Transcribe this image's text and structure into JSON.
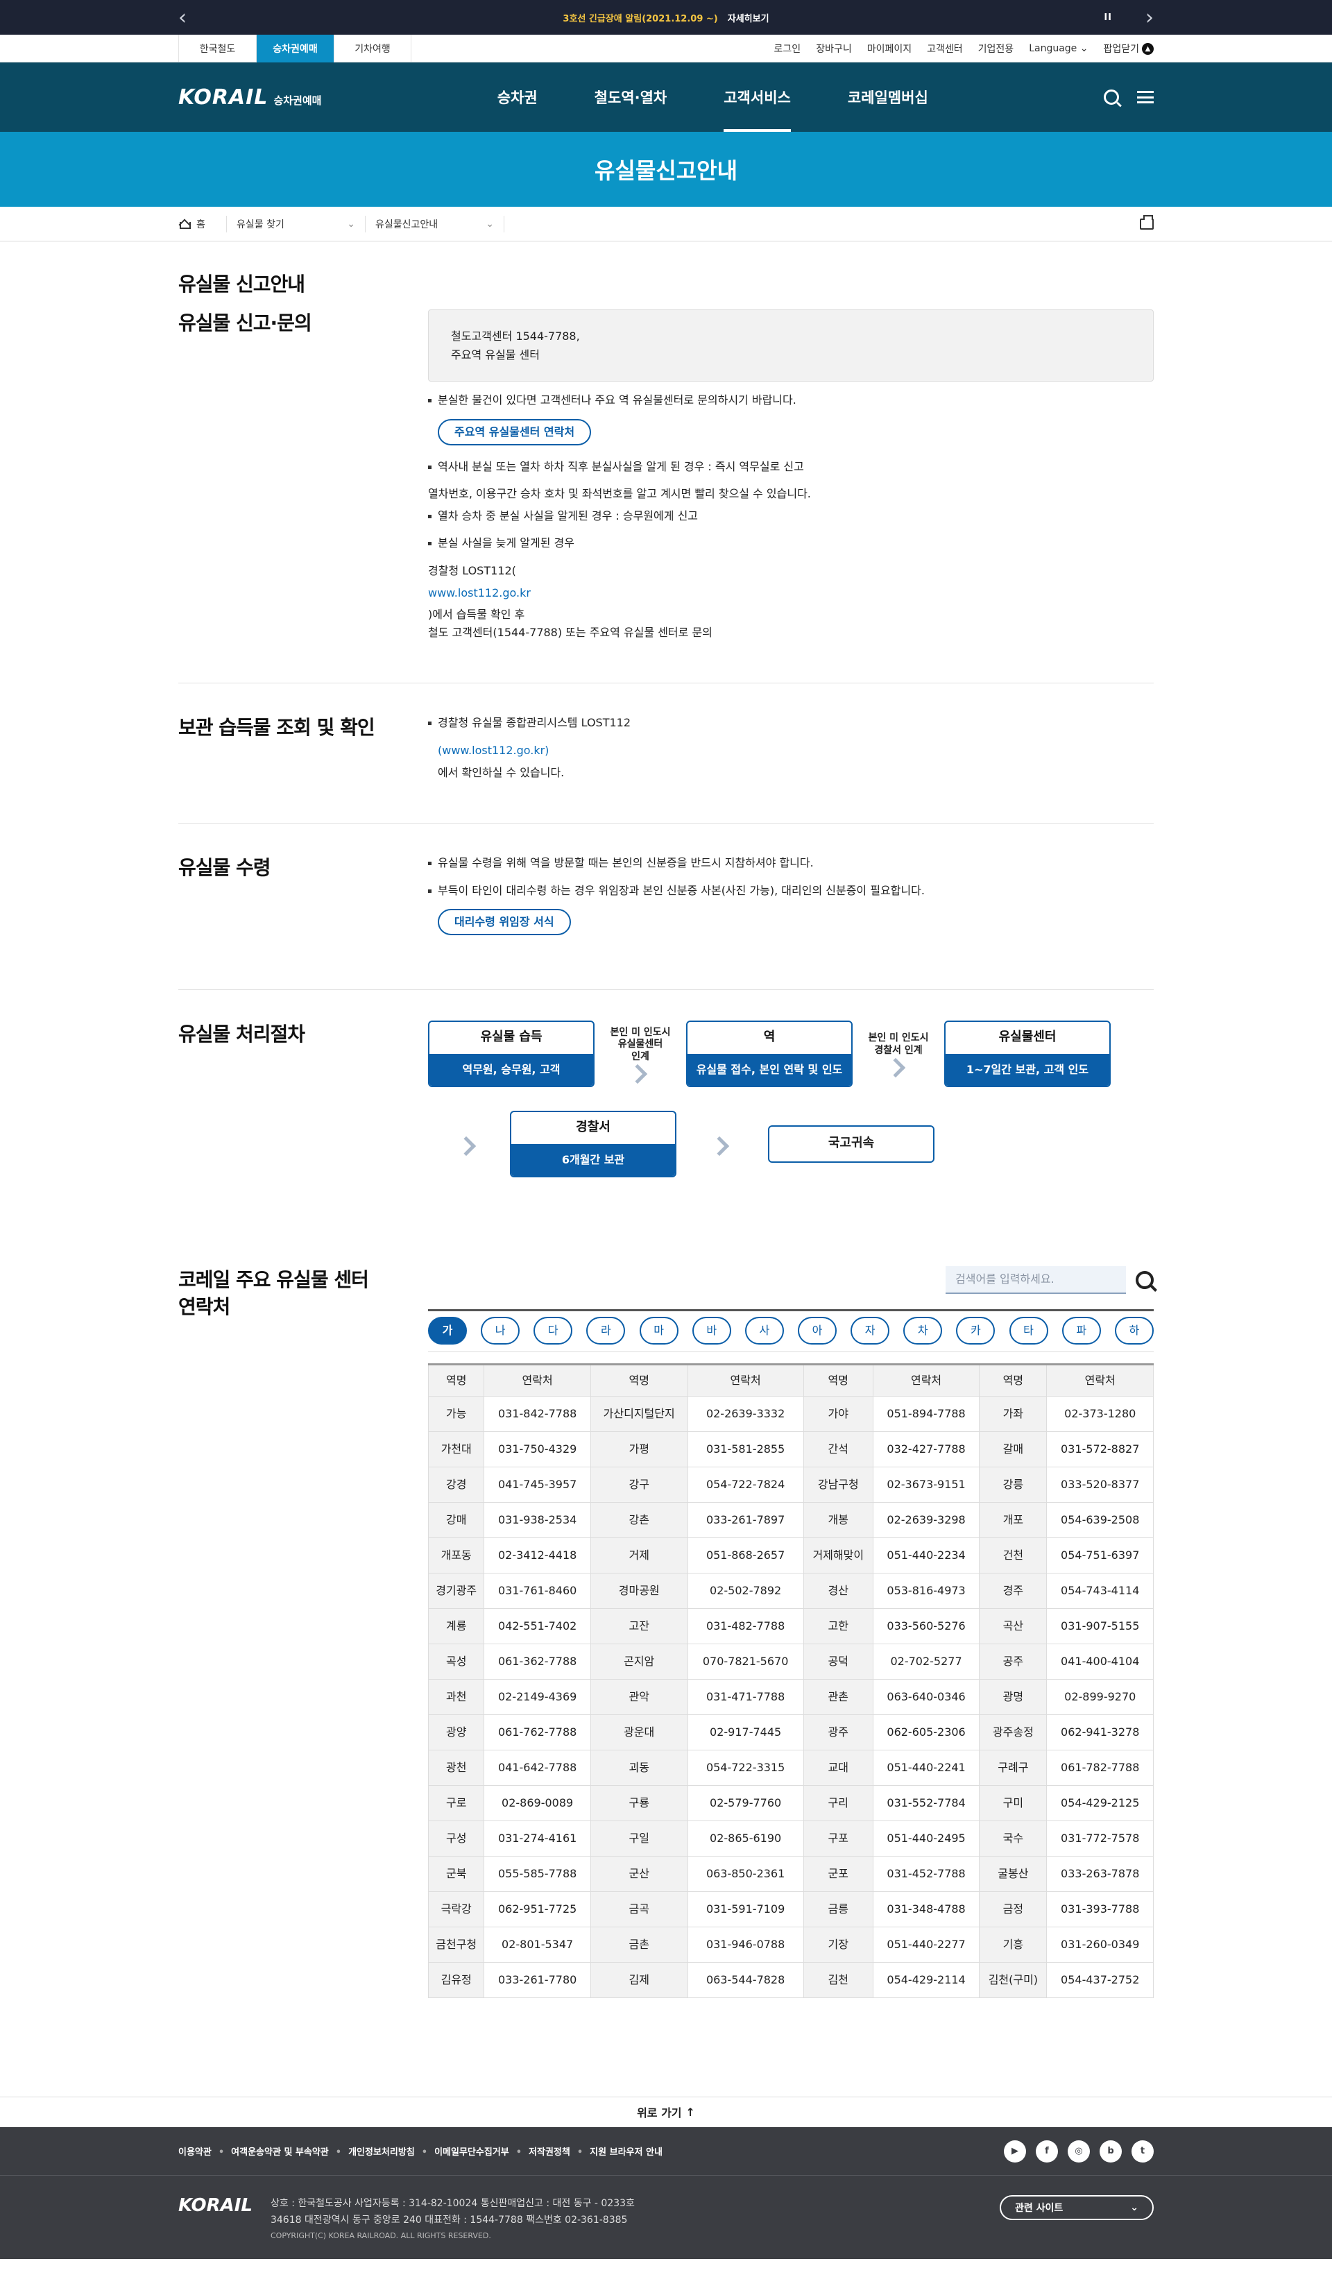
{
  "alert": {
    "message": "3호선 긴급장애 알림(2021.12.09 ~)",
    "more": "자세히보기",
    "pause": "II"
  },
  "util": {
    "sites": [
      "한국철도",
      "승차권예매",
      "기차여행"
    ],
    "links": [
      "로그인",
      "장바구니",
      "마이페이지",
      "고객센터",
      "기업전용",
      "Language",
      "팝업닫기"
    ]
  },
  "gnb": {
    "logo": "KORAIL",
    "logo_sub": "승차권예매",
    "menu": [
      "승차권",
      "철도역·열차",
      "고객서비스",
      "코레일멤버십"
    ]
  },
  "banner": {
    "title": "유실물신고안내"
  },
  "breadcrumb": {
    "home": "홈",
    "level1": "유실물 찾기",
    "level2": "유실물신고안내"
  },
  "page": {
    "title": "유실물 신고안내"
  },
  "report": {
    "title": "유실물 신고·문의",
    "box_line1": "철도고객센터 1544-7788,",
    "box_line2": "주요역 유실물 센터",
    "bullet1": "분실한 물건이 있다면 고객센터나 주요 역 유실물센터로 문의하시기 바랍니다.",
    "button": "주요역 유실물센터 연락처",
    "bullet2": "역사내 분실 또는 열차 하차 직후 분실사실을 알게 된 경우 : 즉시 역무실로 신고",
    "line_after2": "열차번호, 이용구간 승차 호차 및 좌석번호를 알고 계시면 빨리 찾으실 수 있습니다.",
    "bullet3": "열차 승차 중 분실 사실을 알게된 경우 : 승무원에게 신고",
    "bullet4": "분실 사실을 늦게 알게된 경우",
    "police": "경찰청 LOST112(",
    "url": "www.lost112.go.kr",
    "after_url": ")에서 습득물 확인 후",
    "last": "철도 고객센터(1544-7788) 또는 주요역 유실물 센터로 문의"
  },
  "storage": {
    "title": "보관 습득물 조회 및 확인",
    "bullet": "경찰청 유실물 종합관리시스템 LOST112",
    "url": "(www.lost112.go.kr)",
    "after": "에서 확인하실 수 있습니다."
  },
  "receive": {
    "title": "유실물 수령",
    "bullet1": "유실물 수령을 위해 역을 방문할 때는 본인의 신분증을 반드시 지참하셔야 합니다.",
    "bullet2": "부득이 타인이 대리수령 하는 경우 위임장과 본인 신분증 사본(사진 가능), 대리인의 신분증이 필요합니다.",
    "button": "대리수령 위임장 서식"
  },
  "process": {
    "title": "유실물 처리절차",
    "box1_title": "유실물 습득",
    "box1_desc": "역무원, 승무원, 고객",
    "conn1": [
      "본인 미 인도시",
      "유실물센터",
      "인계"
    ],
    "box2_title": "역",
    "box2_desc": "유실물 접수, 본인 연락 및 인도",
    "conn2": [
      "본인 미 인도시",
      "경찰서 인계"
    ],
    "box3_title": "유실물센터",
    "box3_desc": "1~7일간 보관, 고객 인도",
    "box4_title": "경찰서",
    "box4_desc": "6개월간 보관",
    "box5_title": "국고귀속"
  },
  "contacts": {
    "title_line1": "코레일 주요 유실물 센터",
    "title_line2": "연락처",
    "search_placeholder": "검색어를 입력하세요.",
    "tabs": [
      "가",
      "나",
      "다",
      "라",
      "마",
      "바",
      "사",
      "아",
      "자",
      "차",
      "카",
      "타",
      "파",
      "하"
    ],
    "headers": [
      "역명",
      "연락처",
      "역명",
      "연락처",
      "역명",
      "연락처",
      "역명",
      "연락처"
    ],
    "rows": [
      [
        "가능",
        "031-842-7788",
        "가산디지털단지",
        "02-2639-3332",
        "가야",
        "051-894-7788",
        "가좌",
        "02-373-1280"
      ],
      [
        "가천대",
        "031-750-4329",
        "가평",
        "031-581-2855",
        "간석",
        "032-427-7788",
        "갈매",
        "031-572-8827"
      ],
      [
        "강경",
        "041-745-3957",
        "강구",
        "054-722-7824",
        "강남구청",
        "02-3673-9151",
        "강릉",
        "033-520-8377"
      ],
      [
        "강매",
        "031-938-2534",
        "강촌",
        "033-261-7897",
        "개봉",
        "02-2639-3298",
        "개포",
        "054-639-2508"
      ],
      [
        "개포동",
        "02-3412-4418",
        "거제",
        "051-868-2657",
        "거제해맞이",
        "051-440-2234",
        "건천",
        "054-751-6397"
      ],
      [
        "경기광주",
        "031-761-8460",
        "경마공원",
        "02-502-7892",
        "경산",
        "053-816-4973",
        "경주",
        "054-743-4114"
      ],
      [
        "계룡",
        "042-551-7402",
        "고잔",
        "031-482-7788",
        "고한",
        "033-560-5276",
        "곡산",
        "031-907-5155"
      ],
      [
        "곡성",
        "061-362-7788",
        "곤지암",
        "070-7821-5670",
        "공덕",
        "02-702-5277",
        "공주",
        "041-400-4104"
      ],
      [
        "과천",
        "02-2149-4369",
        "관악",
        "031-471-7788",
        "관촌",
        "063-640-0346",
        "광명",
        "02-899-9270"
      ],
      [
        "광양",
        "061-762-7788",
        "광운대",
        "02-917-7445",
        "광주",
        "062-605-2306",
        "광주송정",
        "062-941-3278"
      ],
      [
        "광천",
        "041-642-7788",
        "괴동",
        "054-722-3315",
        "교대",
        "051-440-2241",
        "구례구",
        "061-782-7788"
      ],
      [
        "구로",
        "02-869-0089",
        "구룡",
        "02-579-7760",
        "구리",
        "031-552-7784",
        "구미",
        "054-429-2125"
      ],
      [
        "구성",
        "031-274-4161",
        "구일",
        "02-865-6190",
        "구포",
        "051-440-2495",
        "국수",
        "031-772-7578"
      ],
      [
        "군북",
        "055-585-7788",
        "군산",
        "063-850-2361",
        "군포",
        "031-452-7788",
        "굴봉산",
        "033-263-7878"
      ],
      [
        "극락강",
        "062-951-7725",
        "금곡",
        "031-591-7109",
        "금릉",
        "031-348-4788",
        "금정",
        "031-393-7788"
      ],
      [
        "금천구청",
        "02-801-5347",
        "금촌",
        "031-946-0788",
        "기장",
        "051-440-2277",
        "기흥",
        "031-260-0349"
      ],
      [
        "김유정",
        "033-261-7780",
        "김제",
        "063-544-7828",
        "김천",
        "054-429-2114",
        "김천(구미)",
        "054-437-2752"
      ]
    ]
  },
  "totop": "위로 가기",
  "footer": {
    "links": [
      "이용약관",
      "여객운송약관 및 부속약관",
      "개인정보처리방침",
      "이메일무단수집거부",
      "저작권정책",
      "지원 브라우저 안내"
    ],
    "sns": [
      "▶",
      "f",
      "◎",
      "b",
      "t"
    ],
    "logo": "KORAIL",
    "info1": "상호 : 한국철도공사   사업자등록 : 314-82-10024   통신판매업신고 : 대전 동구 - 0233호",
    "info2": "34618 대전광역시 동구 중앙로 240   대표전화 : 1544-7788   팩스번호 02-361-8385",
    "copyright": "COPYRIGHT(C) KOREA RAILROAD. ALL RIGHTS RESERVED.",
    "related": "관련 사이트"
  }
}
